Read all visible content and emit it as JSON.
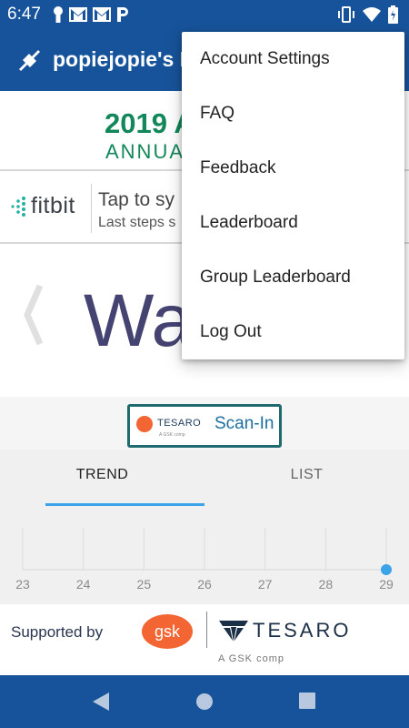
{
  "status_bar": {
    "time": "6:47",
    "left_icons": [
      "keyhole-icon",
      "gmail-icon",
      "gmail-icon",
      "parking-icon"
    ],
    "right_icons": [
      "vibrate-icon",
      "wifi-icon",
      "battery-charging-icon"
    ]
  },
  "app_bar": {
    "title": "popiejopie's D",
    "logo_icon": "sneaker-icon",
    "color": "#17539a"
  },
  "banner": {
    "year": "2019 A",
    "subtitle": "ANNUA",
    "color": "#12875a"
  },
  "fitbit": {
    "brand": "fitbit",
    "sync_title": "Tap to sy",
    "sync_subtitle": "Last steps s"
  },
  "carousel": {
    "title": "Wa",
    "prev_icon": "chevron-left-icon"
  },
  "scan_in": {
    "gsk": "gsk",
    "tesaro": "TESARO",
    "tesaro_sub": "A GSK comp",
    "label": "Scan-In",
    "border_color": "#1f6b70"
  },
  "tabs": [
    {
      "label": "TREND",
      "selected": true
    },
    {
      "label": "LIST",
      "selected": false
    }
  ],
  "chart_data": {
    "type": "scatter",
    "categories": [
      "23",
      "24",
      "25",
      "26",
      "27",
      "28",
      "29"
    ],
    "points": [
      {
        "x": "29",
        "y": 0
      }
    ],
    "point_color": "#3ba3e8",
    "grid": true
  },
  "footer": {
    "supported_by": "Supported by",
    "gsk": "gsk",
    "tesaro": "TESARO",
    "tesaro_sub": "A GSK comp"
  },
  "nav_bar": {
    "buttons": [
      "back-icon",
      "home-icon",
      "recents-icon"
    ]
  },
  "menu": {
    "items": [
      {
        "label": "Account Settings"
      },
      {
        "label": "FAQ"
      },
      {
        "label": "Feedback"
      },
      {
        "label": "Leaderboard"
      },
      {
        "label": "Group Leaderboard"
      },
      {
        "label": "Log Out"
      }
    ]
  }
}
